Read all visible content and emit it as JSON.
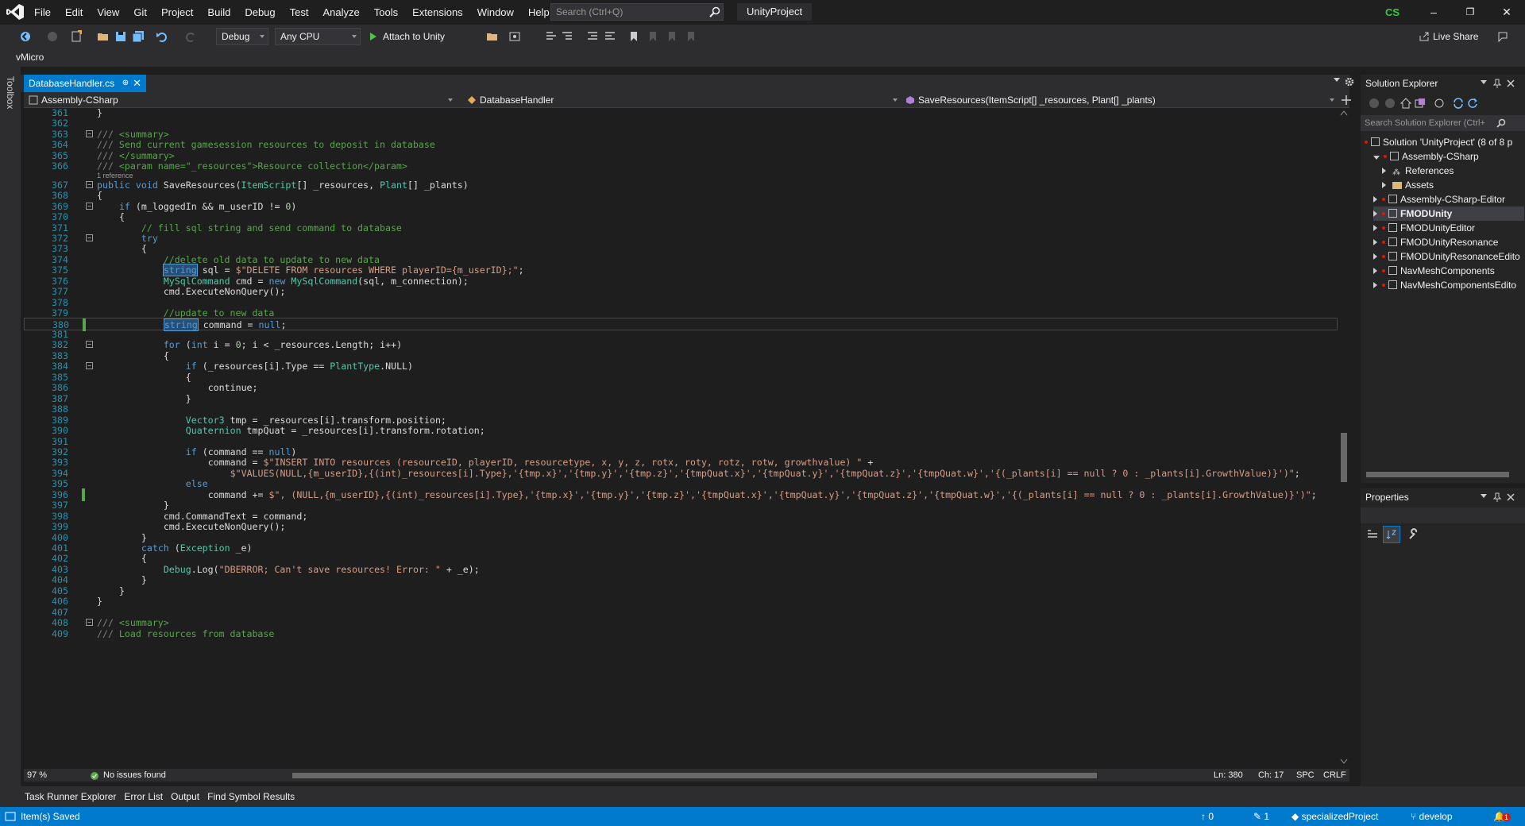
{
  "menu": [
    "File",
    "Edit",
    "View",
    "Git",
    "Project",
    "Build",
    "Debug",
    "Test",
    "Analyze",
    "Tools",
    "Extensions",
    "Window",
    "Help"
  ],
  "search": {
    "placeholder": "Search (Ctrl+Q)"
  },
  "project_name": "UnityProject",
  "account_initials": "CS",
  "window_controls": {
    "minimize": "–",
    "restore": "❐",
    "close": "✕"
  },
  "toolbar": {
    "config": "Debug",
    "platform": "Any CPU",
    "attach": "Attach to Unity",
    "live_share": "Live Share"
  },
  "toolbar2": {
    "vmicro": "vMicro"
  },
  "toolbox_label": "Toolbox",
  "file_tab": {
    "name": "DatabaseHandler.cs",
    "pin": "⊕",
    "close": "✕"
  },
  "navbar": {
    "project": "Assembly-CSharp",
    "class": "DatabaseHandler",
    "member": "SaveResources(ItemScript[] _resources, Plant[] _plants)"
  },
  "editor": {
    "codelens": "1 reference",
    "lines": [
      {
        "n": "361",
        "t": "}"
      },
      {
        "n": "362",
        "t": ""
      },
      {
        "n": "363",
        "t": "/// <summary>"
      },
      {
        "n": "364",
        "t": "/// Send current gamesession resources to deposit in database"
      },
      {
        "n": "365",
        "t": "/// </summary>"
      },
      {
        "n": "366",
        "t": "/// <param name=\"_resources\">Resource collection</param>"
      },
      {
        "n": "367",
        "t": "public void SaveResources(ItemScript[] _resources, Plant[] _plants)"
      },
      {
        "n": "368",
        "t": "{"
      },
      {
        "n": "369",
        "t": "    if (m_loggedIn && m_userID != 0)"
      },
      {
        "n": "370",
        "t": "    {"
      },
      {
        "n": "371",
        "t": "        // fill sql string and send command to database"
      },
      {
        "n": "372",
        "t": "        try"
      },
      {
        "n": "373",
        "t": "        {"
      },
      {
        "n": "374",
        "t": "            //delete old data to update to new data"
      },
      {
        "n": "375",
        "t": "            string sql = $\"DELETE FROM resources WHERE playerID={m_userID};\";"
      },
      {
        "n": "376",
        "t": "            MySqlCommand cmd = new MySqlCommand(sql, m_connection);"
      },
      {
        "n": "377",
        "t": "            cmd.ExecuteNonQuery();"
      },
      {
        "n": "378",
        "t": ""
      },
      {
        "n": "379",
        "t": "            //update to new data"
      },
      {
        "n": "380",
        "t": "            string command = null;"
      },
      {
        "n": "381",
        "t": ""
      },
      {
        "n": "382",
        "t": "            for (int i = 0; i < _resources.Length; i++)"
      },
      {
        "n": "383",
        "t": "            {"
      },
      {
        "n": "384",
        "t": "                if (_resources[i].Type == PlantType.NULL)"
      },
      {
        "n": "385",
        "t": "                {"
      },
      {
        "n": "386",
        "t": "                    continue;"
      },
      {
        "n": "387",
        "t": "                }"
      },
      {
        "n": "388",
        "t": ""
      },
      {
        "n": "389",
        "t": "                Vector3 tmp = _resources[i].transform.position;"
      },
      {
        "n": "390",
        "t": "                Quaternion tmpQuat = _resources[i].transform.rotation;"
      },
      {
        "n": "391",
        "t": ""
      },
      {
        "n": "392",
        "t": "                if (command == null)"
      },
      {
        "n": "393",
        "t": "                    command = $\"INSERT INTO resources (resourceID, playerID, resourcetype, x, y, z, rotx, roty, rotz, rotw, growthvalue) \" +"
      },
      {
        "n": "394",
        "t": "                        $\"VALUES(NULL,{m_userID},{(int)_resources[i].Type},'{tmp.x}','{tmp.y}','{tmp.z}','{tmpQuat.x}','{tmpQuat.y}','{tmpQuat.z}','{tmpQuat.w}','{(_plants[i] == null ? 0 : _plants[i].GrowthValue)}')\";"
      },
      {
        "n": "395",
        "t": "                else"
      },
      {
        "n": "396",
        "t": "                    command += $\", (NULL,{m_userID},{(int)_resources[i].Type},'{tmp.x}','{tmp.y}','{tmp.z}','{tmpQuat.x}','{tmpQuat.y}','{tmpQuat.z}','{tmpQuat.w}','{(_plants[i] == null ? 0 : _plants[i].GrowthValue)}')\";"
      },
      {
        "n": "397",
        "t": "            }"
      },
      {
        "n": "398",
        "t": "            cmd.CommandText = command;"
      },
      {
        "n": "399",
        "t": "            cmd.ExecuteNonQuery();"
      },
      {
        "n": "400",
        "t": "        }"
      },
      {
        "n": "401",
        "t": "        catch (Exception _e)"
      },
      {
        "n": "402",
        "t": "        {"
      },
      {
        "n": "403",
        "t": "            Debug.Log(\"DBERROR; Can't save resources! Error: \" + _e);"
      },
      {
        "n": "404",
        "t": "        }"
      },
      {
        "n": "405",
        "t": "    }"
      },
      {
        "n": "406",
        "t": "}"
      },
      {
        "n": "407",
        "t": ""
      },
      {
        "n": "408",
        "t": "/// <summary>"
      },
      {
        "n": "409",
        "t": "/// Load resources from database"
      }
    ]
  },
  "editor_status": {
    "zoom": "97 %",
    "issues": "No issues found",
    "line": "Ln: 380",
    "col": "Ch: 17",
    "whitespace": "SPC",
    "eol": "CRLF"
  },
  "solution_explorer": {
    "title": "Solution Explorer",
    "search_placeholder": "Search Solution Explorer (Ctrl+",
    "items": [
      {
        "label": "Solution 'UnityProject' (8 of 8 p",
        "level": 0,
        "kind": "solution"
      },
      {
        "label": "Assembly-CSharp",
        "level": 1,
        "kind": "project",
        "expanded": true
      },
      {
        "label": "References",
        "level": 2,
        "kind": "references"
      },
      {
        "label": "Assets",
        "level": 2,
        "kind": "folder"
      },
      {
        "label": "Assembly-CSharp-Editor",
        "level": 1,
        "kind": "project"
      },
      {
        "label": "FMODUnity",
        "level": 1,
        "kind": "project",
        "bold": true
      },
      {
        "label": "FMODUnityEditor",
        "level": 1,
        "kind": "project"
      },
      {
        "label": "FMODUnityResonance",
        "level": 1,
        "kind": "project"
      },
      {
        "label": "FMODUnityResonanceEdito",
        "level": 1,
        "kind": "project"
      },
      {
        "label": "NavMeshComponents",
        "level": 1,
        "kind": "project"
      },
      {
        "label": "NavMeshComponentsEdito",
        "level": 1,
        "kind": "project"
      }
    ]
  },
  "properties": {
    "title": "Properties"
  },
  "bottom_tabs": [
    "Task Runner Explorer",
    "Error List",
    "Output",
    "Find Symbol Results"
  ],
  "statusbar": {
    "message": "Item(s) Saved",
    "up_count": "0",
    "edit_count": "1",
    "repo": "specializedProject",
    "branch": "develop",
    "notif_count": "1"
  },
  "colors": {
    "accent": "#007acc",
    "editor_bg": "#1e1e1e",
    "chrome_bg": "#2d2d30",
    "keyword": "#569cd6",
    "comment": "#57a64a",
    "string": "#d69d85",
    "type": "#4ec9b0",
    "line_number": "#2b91af"
  }
}
